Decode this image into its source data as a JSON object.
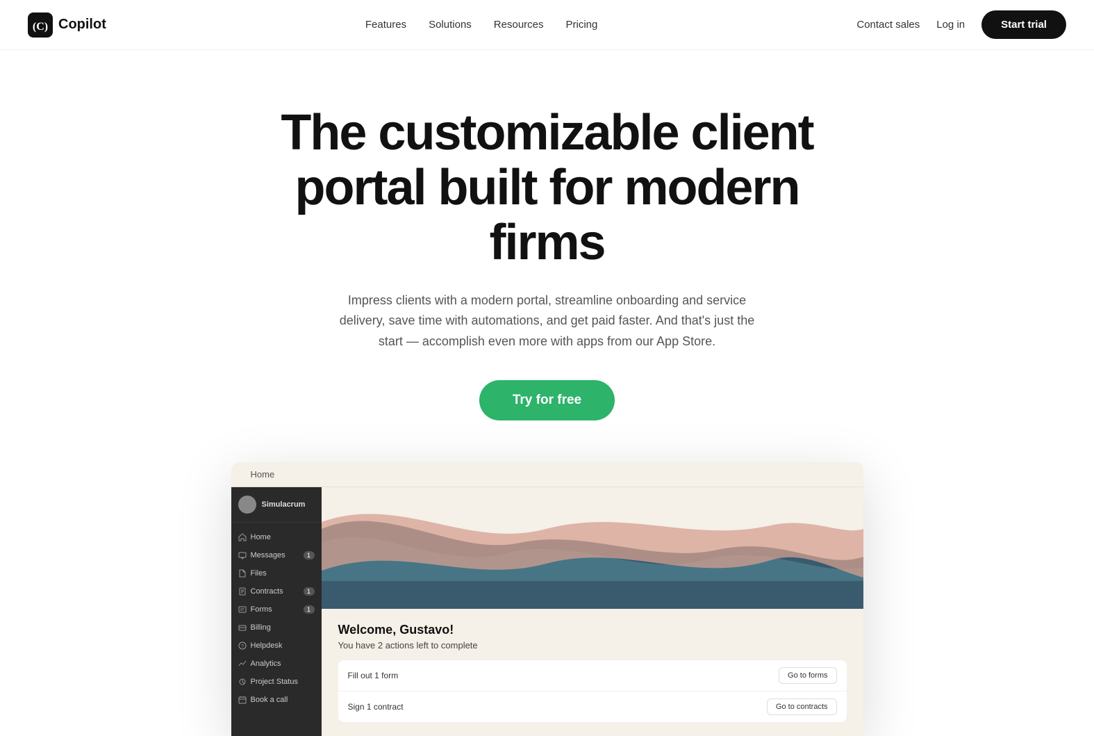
{
  "nav": {
    "logo_text": "Copilot",
    "links": [
      "Features",
      "Solutions",
      "Resources",
      "Pricing"
    ],
    "contact_sales": "Contact sales",
    "login": "Log in",
    "start_trial": "Start trial"
  },
  "hero": {
    "heading": "The customizable client portal built for modern firms",
    "subtext": "Impress clients with a modern portal, streamline onboarding and service delivery, save time with automations, and get paid faster. And that's just the start — accomplish even more with apps from our App Store.",
    "cta": "Try for free"
  },
  "preview": {
    "window_tab": "Home",
    "sidebar": {
      "company": "Simulacrum",
      "items": [
        {
          "label": "Home",
          "icon": "home",
          "badge": null
        },
        {
          "label": "Messages",
          "icon": "message",
          "badge": "1"
        },
        {
          "label": "Files",
          "icon": "file",
          "badge": null
        },
        {
          "label": "Contracts",
          "icon": "contract",
          "badge": "1"
        },
        {
          "label": "Forms",
          "icon": "form",
          "badge": "1"
        },
        {
          "label": "Billing",
          "icon": "billing",
          "badge": null
        },
        {
          "label": "Helpdesk",
          "icon": "helpdesk",
          "badge": null
        },
        {
          "label": "Analytics",
          "icon": "analytics",
          "badge": null
        },
        {
          "label": "Project Status",
          "icon": "project",
          "badge": null
        },
        {
          "label": "Book a call",
          "icon": "calendar",
          "badge": null
        }
      ]
    },
    "welcome": {
      "title": "Welcome, Gustavo!",
      "subtitle": "You have 2 actions left to complete",
      "actions": [
        {
          "label": "Fill out 1 form",
          "button": "Go to forms"
        },
        {
          "label": "Sign 1 contract",
          "button": "Go to contracts"
        }
      ]
    }
  }
}
